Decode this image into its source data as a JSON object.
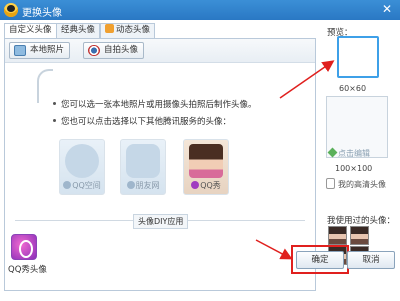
{
  "window": {
    "title": "更换头像",
    "close_glyph": "✕"
  },
  "tabs": [
    {
      "label": "自定义头像",
      "active": true
    },
    {
      "label": "经典头像",
      "active": false
    },
    {
      "label": "动态头像",
      "active": false,
      "icon": "flame-icon"
    }
  ],
  "toolbar": {
    "local_photo": "本地照片",
    "selfie": "自拍头像"
  },
  "hints": [
    "您可以选一张本地照片或用摄像头拍照后制作头像。",
    "您也可以点击选择以下其他腾讯服务的头像："
  ],
  "services": [
    {
      "label": "QQ空间"
    },
    {
      "label": "朋友网"
    },
    {
      "label": "QQ秀"
    }
  ],
  "diy_section": {
    "label": "头像DIY应用",
    "apps": [
      {
        "label": "QQ秀头像"
      }
    ]
  },
  "preview": {
    "title": "预览：",
    "size_small": "60×60",
    "edit_link": "点击编辑",
    "size_large": "100×100",
    "my_hd": "我的高清头像"
  },
  "used": {
    "title": "我使用过的头像："
  },
  "buttons": {
    "ok": "确定",
    "cancel": "取消"
  },
  "colors": {
    "titlebar": "#2a78c4",
    "highlight": "#e0201e",
    "preview_border": "#3ea0e8"
  }
}
